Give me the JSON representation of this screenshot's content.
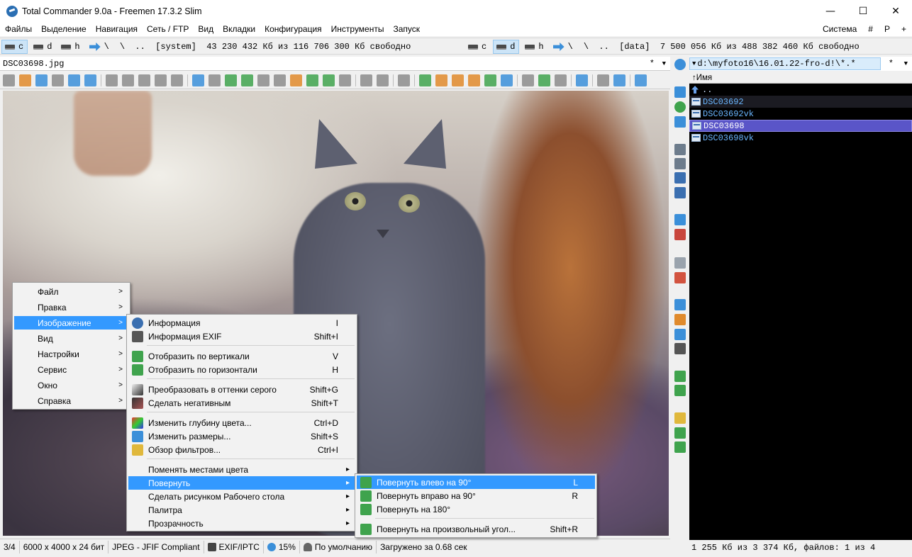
{
  "window": {
    "title": "Total Commander 9.0a - Freemen 17.3.2 Slim",
    "minimize": "—",
    "maximize": "☐",
    "close": "✕"
  },
  "menubar": {
    "items": [
      "Файлы",
      "Выделение",
      "Навигация",
      "Сеть / FTP",
      "Вид",
      "Вкладки",
      "Конфигурация",
      "Инструменты",
      "Запуск"
    ],
    "right": [
      "Система",
      "#",
      "P",
      "+"
    ]
  },
  "drives_left": {
    "drives": [
      "c",
      "d",
      "h"
    ],
    "net": "\\",
    "path": "\\  ..  [system]  43 230 432 Кб из 116 706 300 Кб свободно"
  },
  "drives_right": {
    "drives": [
      "c",
      "d",
      "h"
    ],
    "net": "\\",
    "path": "\\  ..  [data]  7 500 056 Кб из 488 382 460 Кб свободно"
  },
  "lister": {
    "filename": "DSC03698.jpg",
    "star": "*",
    "arrow": "▼"
  },
  "statusbar": {
    "index": "3/4",
    "dimensions": "6000 x 4000 x 24 бит",
    "format": "JPEG - JFIF Compliant",
    "exif": "EXIF/IPTC",
    "zoom": "15%",
    "mode": "По умолчанию",
    "loaded": "Загружено за 0.68 сек"
  },
  "right_panel": {
    "path": "d:\\myfoto16\\16.01.22-fro-d!\\*.*",
    "star": "*",
    "arrow": "▼",
    "column_header": "↑Имя",
    "up": "..",
    "files": [
      "DSC03692",
      "DSC03692vk",
      "DSC03698",
      "DSC03698vk"
    ],
    "selected_index": 2,
    "status": "1 255 Кб из 3 374 Кб, файлов: 1 из 4"
  },
  "menu_main": {
    "items": [
      "Файл",
      "Правка",
      "Изображение",
      "Вид",
      "Настройки",
      "Сервис",
      "Окно",
      "Справка"
    ],
    "highlighted_index": 2,
    "submenu_arrow": ">"
  },
  "menu_image": {
    "items": [
      {
        "label": "Информация",
        "shortcut": "I"
      },
      {
        "label": "Информация EXIF",
        "shortcut": "Shift+I"
      },
      {
        "label": "Отобразить по вертикали",
        "shortcut": "V"
      },
      {
        "label": "Отобразить по горизонтали",
        "shortcut": "H"
      },
      {
        "label": "Преобразовать в оттенки серого",
        "shortcut": "Shift+G"
      },
      {
        "label": "Сделать негативным",
        "shortcut": "Shift+T"
      },
      {
        "label": "Изменить глубину цвета...",
        "shortcut": "Ctrl+D"
      },
      {
        "label": "Изменить размеры...",
        "shortcut": "Shift+S"
      },
      {
        "label": "Обзор фильтров...",
        "shortcut": "Ctrl+I"
      },
      {
        "label": "Поменять местами цвета",
        "shortcut": ""
      },
      {
        "label": "Повернуть",
        "shortcut": ""
      },
      {
        "label": "Сделать рисунком Рабочего стола",
        "shortcut": ""
      },
      {
        "label": "Палитра",
        "shortcut": ""
      },
      {
        "label": "Прозрачность",
        "shortcut": ""
      }
    ],
    "highlighted_index": 10,
    "submenu_arrow": "▸"
  },
  "menu_rotate": {
    "items": [
      {
        "label": "Повернуть влево на 90°",
        "shortcut": "L"
      },
      {
        "label": "Повернуть вправо на 90°",
        "shortcut": "R"
      },
      {
        "label": "Повернуть на 180°",
        "shortcut": ""
      },
      {
        "label": "Повернуть на произвольный угол...",
        "shortcut": "Shift+R"
      }
    ],
    "highlighted_index": 0
  },
  "colors": {
    "highlight": "#3399ff",
    "panel_bg": "#000000",
    "file_text": "#6ab6ff",
    "selected_row": "#5a55c8"
  }
}
